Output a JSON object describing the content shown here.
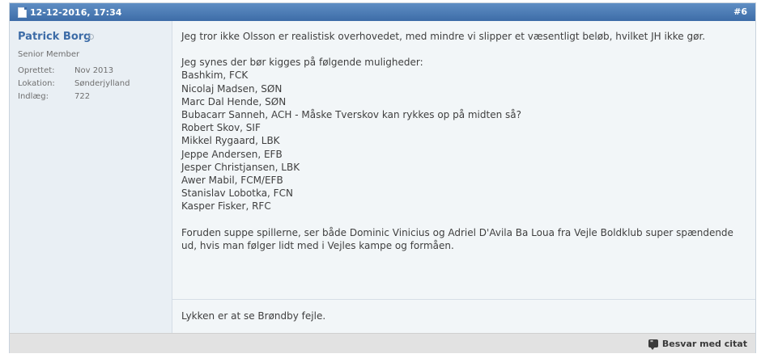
{
  "post": {
    "date": "12-12-2016, 17:34",
    "number": "#6"
  },
  "user": {
    "name": "Patrick Borg",
    "title": "Senior Member",
    "stats": [
      {
        "label": "Oprettet:",
        "value": "Nov 2013"
      },
      {
        "label": "Lokation:",
        "value": "Sønderjylland"
      },
      {
        "label": "Indlæg:",
        "value": "722"
      }
    ]
  },
  "message": {
    "intro": "Jeg tror ikke Olsson er realistisk overhovedet, med mindre vi slipper et væsentligt beløb, hvilket JH ikke gør.",
    "list_heading": "Jeg synes der bør kigges på følgende muligheder:",
    "players": [
      "Bashkim, FCK",
      "Nicolaj Madsen, SØN",
      "Marc Dal Hende, SØN",
      "Bubacarr Sanneh, ACH - Måske Tverskov kan rykkes op på midten så?",
      "Robert Skov, SIF",
      "Mikkel Rygaard, LBK",
      "Jeppe Andersen, EFB",
      "Jesper Christjansen, LBK",
      "Awer Mabil, FCM/EFB",
      "Stanislav Lobotka, FCN",
      "Kasper Fisker, RFC"
    ],
    "closing": "Foruden suppe spillerne, ser både Dominic Vinicius og Adriel D'Avila Ba Loua fra Vejle Boldklub super spændende ud, hvis man følger lidt med i Vejles kampe og formåen."
  },
  "signature": "Lykken er at se Brøndby fejle.",
  "footer": {
    "quote_label": "Besvar med citat",
    "quote_icon": "quote-bubble-icon"
  }
}
